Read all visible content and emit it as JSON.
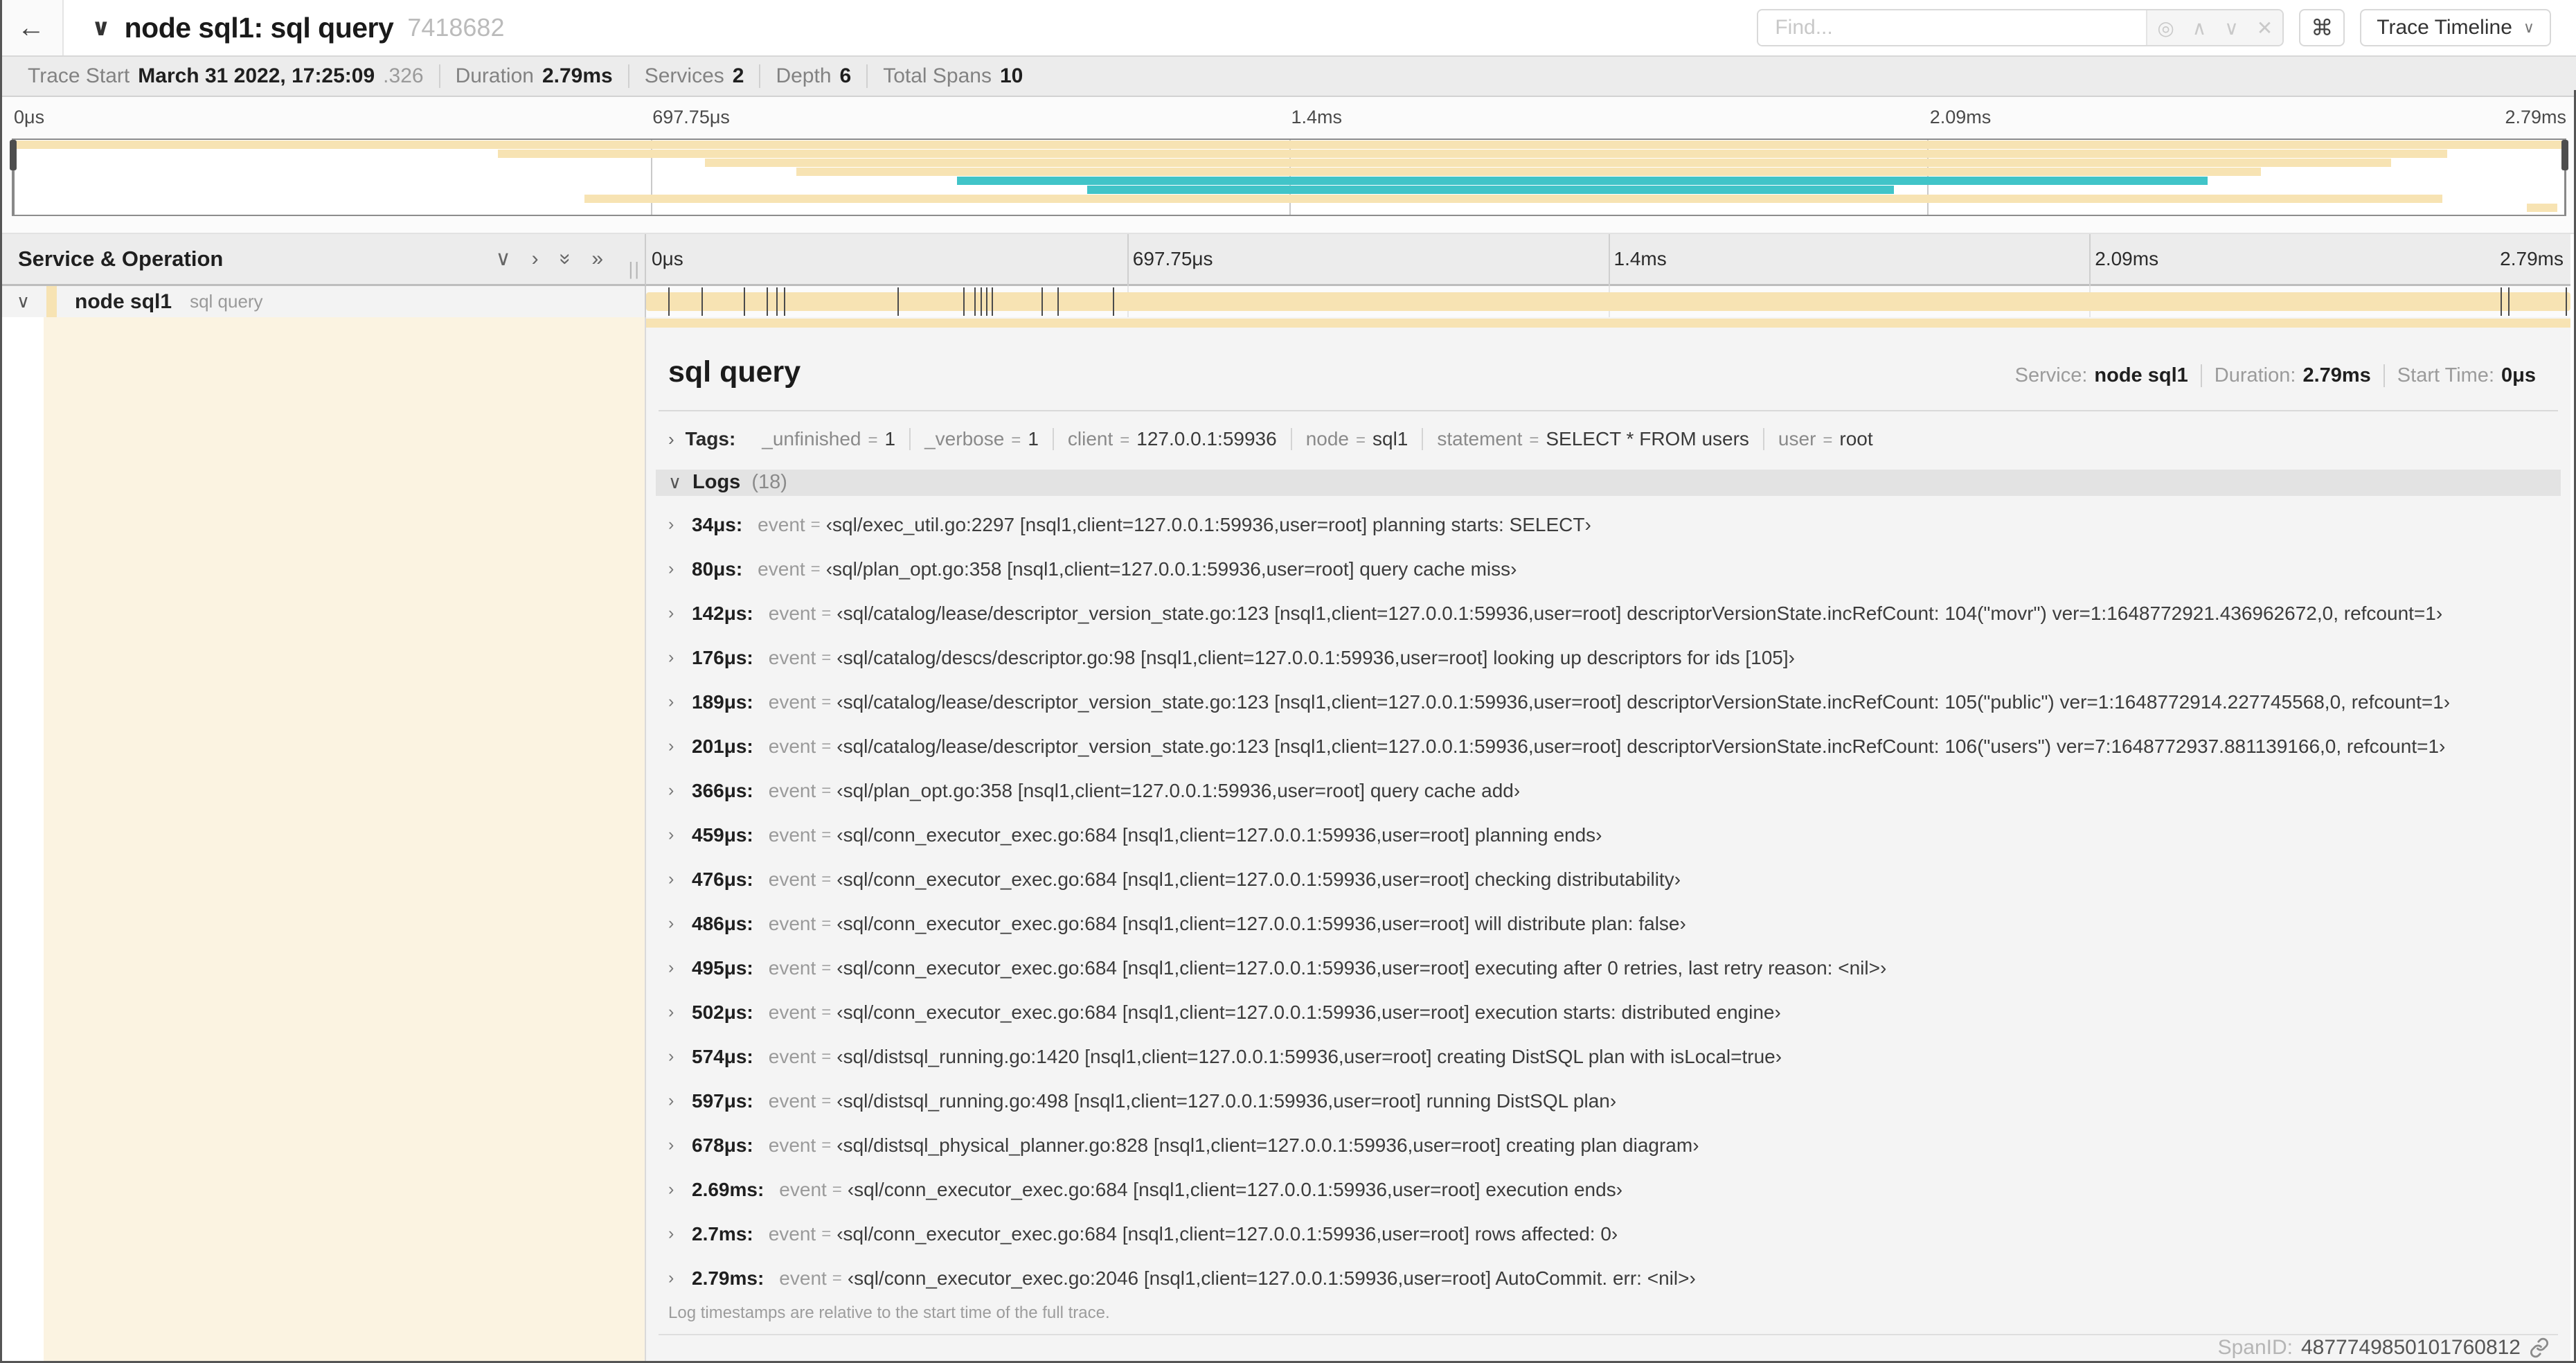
{
  "colors": {
    "span_tan": "#F7E3B3",
    "span_teal": "#41C4C8",
    "indent_cream": "#FBF3E1",
    "tick": "#4B4B4B"
  },
  "header": {
    "back_icon": "←",
    "title": "node sql1: sql query",
    "trace_id_short": "7418682",
    "find_placeholder": "Find...",
    "shortcut_button": "⌘",
    "view_selector": "Trace Timeline"
  },
  "summary": {
    "items": [
      {
        "label": "Trace Start",
        "value": "March 31 2022, 17:25:09",
        "suffix": ".326"
      },
      {
        "label": "Duration",
        "value": "2.79ms"
      },
      {
        "label": "Services",
        "value": "2"
      },
      {
        "label": "Depth",
        "value": "6"
      },
      {
        "label": "Total Spans",
        "value": "10"
      }
    ]
  },
  "minimap": {
    "labels": [
      {
        "text": "0μs",
        "pos": 0
      },
      {
        "text": "697.75μs",
        "pos": 0.25
      },
      {
        "text": "1.4ms",
        "pos": 0.5
      },
      {
        "text": "2.09ms",
        "pos": 0.75
      },
      {
        "text": "2.79ms",
        "pos": 1
      }
    ],
    "spans": [
      {
        "start": 0,
        "end": 1,
        "color": "tan"
      },
      {
        "start": 0.19,
        "end": 0.954,
        "color": "tan"
      },
      {
        "start": 0.271,
        "end": 0.932,
        "color": "tan"
      },
      {
        "start": 0.307,
        "end": 0.881,
        "color": "tan"
      },
      {
        "start": 0.37,
        "end": 0.86,
        "color": "teal"
      },
      {
        "start": 0.421,
        "end": 0.737,
        "color": "teal"
      },
      {
        "start": 0.224,
        "end": 0.952,
        "color": "tan"
      },
      {
        "start": 0.985,
        "end": 0.997,
        "color": "tan"
      }
    ]
  },
  "timeline": {
    "columns_header": "Service & Operation",
    "ruler_labels": [
      {
        "text": "0μs",
        "pos": 0
      },
      {
        "text": "697.75μs",
        "pos": 0.25
      },
      {
        "text": "1.4ms",
        "pos": 0.5
      },
      {
        "text": "2.09ms",
        "pos": 0.75
      },
      {
        "text": "2.79ms",
        "pos": 1
      }
    ],
    "row": {
      "service": "node sql1",
      "operation": "sql query",
      "bar_start": 0,
      "bar_end": 1,
      "ticks": [
        0.012,
        0.029,
        0.051,
        0.063,
        0.068,
        0.072,
        0.131,
        0.165,
        0.171,
        0.174,
        0.177,
        0.18,
        0.206,
        0.214,
        0.243,
        0.964,
        0.968,
        0.998
      ]
    }
  },
  "detail": {
    "title": "sql query",
    "meta": [
      {
        "label": "Service:",
        "value": "node sql1"
      },
      {
        "label": "Duration:",
        "value": "2.79ms"
      },
      {
        "label": "Start Time:",
        "value": "0μs"
      }
    ],
    "tags_label": "Tags:",
    "tags": [
      {
        "key": "_unfinished",
        "value": "1"
      },
      {
        "key": "_verbose",
        "value": "1"
      },
      {
        "key": "client",
        "value": "127.0.0.1:59936"
      },
      {
        "key": "node",
        "value": "sql1"
      },
      {
        "key": "statement",
        "value": "SELECT * FROM users"
      },
      {
        "key": "user",
        "value": "root"
      }
    ],
    "logs_label": "Logs",
    "logs_count_display": "(18)",
    "log_field_key": "event",
    "logs": [
      {
        "t": "34μs",
        "value": "‹sql/exec_util.go:2297 [nsql1,client=127.0.0.1:59936,user=root] planning starts: SELECT›"
      },
      {
        "t": "80μs",
        "value": "‹sql/plan_opt.go:358 [nsql1,client=127.0.0.1:59936,user=root] query cache miss›"
      },
      {
        "t": "142μs",
        "value": "‹sql/catalog/lease/descriptor_version_state.go:123 [nsql1,client=127.0.0.1:59936,user=root] descriptorVersionState.incRefCount: 104(\"movr\") ver=1:1648772921.436962672,0, refcount=1›"
      },
      {
        "t": "176μs",
        "value": "‹sql/catalog/descs/descriptor.go:98 [nsql1,client=127.0.0.1:59936,user=root] looking up descriptors for ids [105]›"
      },
      {
        "t": "189μs",
        "value": "‹sql/catalog/lease/descriptor_version_state.go:123 [nsql1,client=127.0.0.1:59936,user=root] descriptorVersionState.incRefCount: 105(\"public\") ver=1:1648772914.227745568,0, refcount=1›"
      },
      {
        "t": "201μs",
        "value": "‹sql/catalog/lease/descriptor_version_state.go:123 [nsql1,client=127.0.0.1:59936,user=root] descriptorVersionState.incRefCount: 106(\"users\") ver=7:1648772937.881139166,0, refcount=1›"
      },
      {
        "t": "366μs",
        "value": "‹sql/plan_opt.go:358 [nsql1,client=127.0.0.1:59936,user=root] query cache add›"
      },
      {
        "t": "459μs",
        "value": "‹sql/conn_executor_exec.go:684 [nsql1,client=127.0.0.1:59936,user=root] planning ends›"
      },
      {
        "t": "476μs",
        "value": "‹sql/conn_executor_exec.go:684 [nsql1,client=127.0.0.1:59936,user=root] checking distributability›"
      },
      {
        "t": "486μs",
        "value": "‹sql/conn_executor_exec.go:684 [nsql1,client=127.0.0.1:59936,user=root] will distribute plan: false›"
      },
      {
        "t": "495μs",
        "value": "‹sql/conn_executor_exec.go:684 [nsql1,client=127.0.0.1:59936,user=root] executing after 0 retries, last retry reason: <nil>›"
      },
      {
        "t": "502μs",
        "value": "‹sql/conn_executor_exec.go:684 [nsql1,client=127.0.0.1:59936,user=root] execution starts: distributed engine›"
      },
      {
        "t": "574μs",
        "value": "‹sql/distsql_running.go:1420 [nsql1,client=127.0.0.1:59936,user=root] creating DistSQL plan with isLocal=true›"
      },
      {
        "t": "597μs",
        "value": "‹sql/distsql_running.go:498 [nsql1,client=127.0.0.1:59936,user=root] running DistSQL plan›"
      },
      {
        "t": "678μs",
        "value": "‹sql/distsql_physical_planner.go:828 [nsql1,client=127.0.0.1:59936,user=root] creating plan diagram›"
      },
      {
        "t": "2.69ms",
        "value": "‹sql/conn_executor_exec.go:684 [nsql1,client=127.0.0.1:59936,user=root] execution ends›"
      },
      {
        "t": "2.7ms",
        "value": "‹sql/conn_executor_exec.go:684 [nsql1,client=127.0.0.1:59936,user=root] rows affected: 0›"
      },
      {
        "t": "2.79ms",
        "value": "‹sql/conn_executor_exec.go:2046 [nsql1,client=127.0.0.1:59936,user=root] AutoCommit. err: <nil>›"
      }
    ],
    "footnote": "Log timestamps are relative to the start time of the full trace.",
    "spanid_label": "SpanID:",
    "spanid_value": "4877749850101760812"
  }
}
